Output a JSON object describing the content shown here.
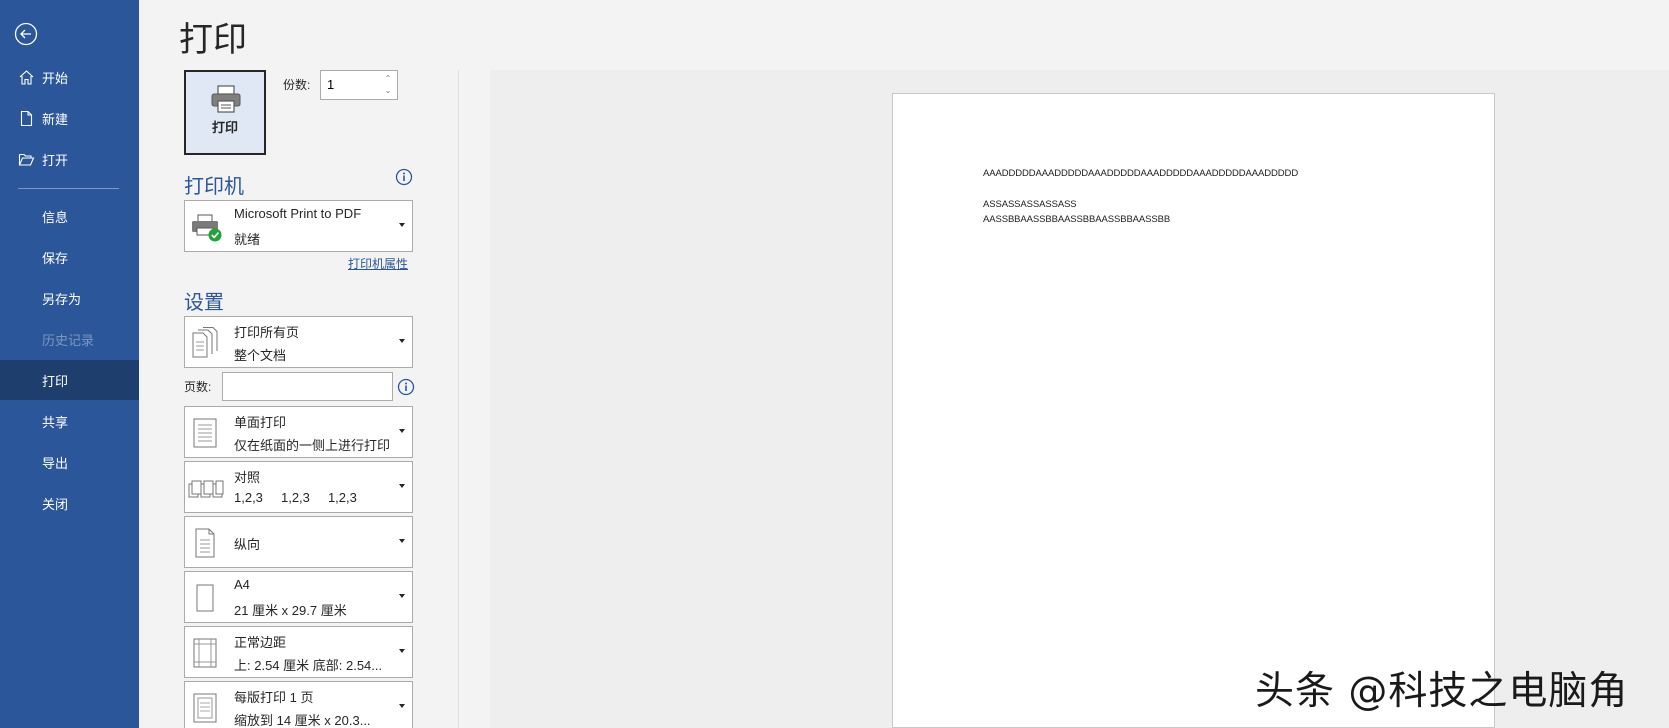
{
  "app": {
    "accent_color": "#2b579a",
    "sidebar_bg": "#2b579a",
    "active_bg": "#1e3e6e"
  },
  "sidebar": {
    "back_icon": "back-arrow-icon",
    "items": [
      {
        "label": "开始",
        "icon": "home-icon"
      },
      {
        "label": "新建",
        "icon": "new-document-icon"
      },
      {
        "label": "打开",
        "icon": "open-folder-icon"
      },
      {
        "label": "信息"
      },
      {
        "label": "保存"
      },
      {
        "label": "另存为"
      },
      {
        "label": "历史记录",
        "disabled": true
      },
      {
        "label": "打印",
        "active": true
      },
      {
        "label": "共享"
      },
      {
        "label": "导出"
      },
      {
        "label": "关闭"
      }
    ]
  },
  "main": {
    "title": "打印",
    "print_button": {
      "label": "打印",
      "icon": "printer-icon"
    },
    "copies": {
      "label": "份数:",
      "value": "1"
    },
    "printer": {
      "section_title": "打印机",
      "name": "Microsoft Print to PDF",
      "status": "就绪",
      "properties_link": "打印机属性",
      "info_icon": "info-icon"
    },
    "settings": {
      "section_title": "设置",
      "pages_label": "页数:",
      "pages_value": "",
      "dropdowns": [
        {
          "line1": "打印所有页",
          "line2": "整个文档",
          "icon": "all-pages-icon"
        },
        {
          "line1": "单面打印",
          "line2": "仅在纸面的一侧上进行打印",
          "icon": "one-sided-icon"
        },
        {
          "line1": "对照",
          "line2": "1,2,3     1,2,3     1,2,3",
          "icon": "collate-icon"
        },
        {
          "line1": "纵向",
          "line2": "",
          "icon": "portrait-icon"
        },
        {
          "line1": "A4",
          "line2": "21 厘米 x 29.7 厘米",
          "icon": "paper-size-icon"
        },
        {
          "line1": "正常边距",
          "line2": "上: 2.54 厘米 底部: 2.54...",
          "icon": "margins-icon"
        },
        {
          "line1": "每版打印 1 页",
          "line2": "缩放到 14 厘米 x 20.3...",
          "icon": "pages-per-sheet-icon"
        }
      ]
    }
  },
  "preview": {
    "lines": [
      "AAADDDDDAAADDDDDAAADDDDDAAADDDDDAAADDDDDAAADDDDD",
      "ASSASSASSASSASS",
      "AASSBBAASSBBAASSBBAASSBBAASSBB"
    ]
  },
  "watermark": "头条 @科技之电脑角"
}
